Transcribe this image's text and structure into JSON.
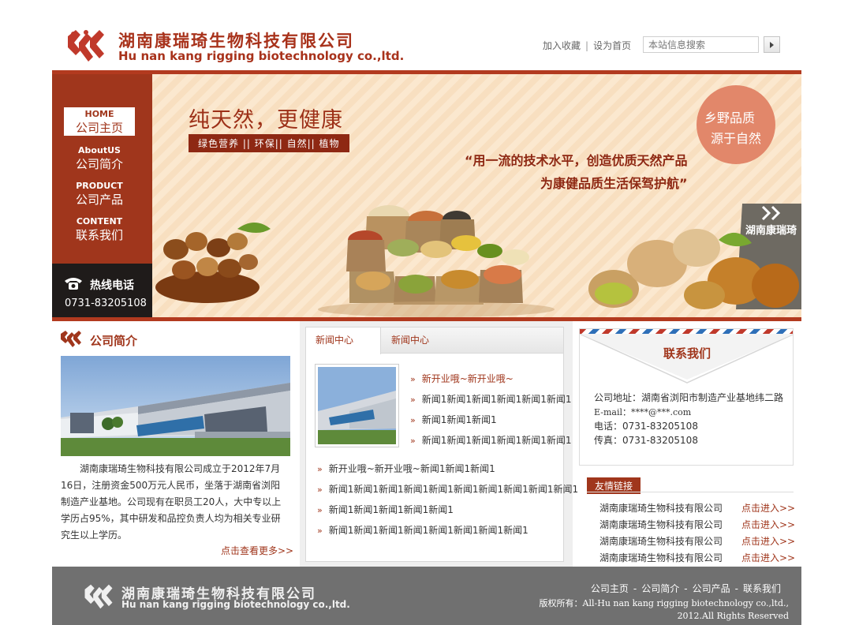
{
  "header": {
    "company_cn": "湖南康瑞琦生物科技有限公司",
    "company_en": "Hu nan kang rigging biotechnology co.,ltd.",
    "bookmark": "加入收藏",
    "separator": "|",
    "set_home": "设为首页",
    "search_placeholder": "本站信息搜索"
  },
  "nav": {
    "items": [
      {
        "en": "HOME",
        "cn": "公司主页"
      },
      {
        "en": "AboutUS",
        "cn": "公司简介"
      },
      {
        "en": "PRODUCT",
        "cn": "公司产品"
      },
      {
        "en": "CONTENT",
        "cn": "联系我们"
      }
    ],
    "hotline_label": "热线电话",
    "hotline_number": "0731-83205108"
  },
  "banner": {
    "slogan": "纯天然，更健康",
    "tag": "绿色营养 || 环保|| 自然|| 植物",
    "quote_line1": "“用一流的技术水平，创造优质天然产品",
    "quote_line2": "为康健品质生活保驾护航”",
    "badge_line1": "乡野品质",
    "badge_line2": "源于自然",
    "bag_label": "湖南康瑞琦"
  },
  "intro": {
    "title": "公司简介",
    "text": "湖南康瑞琦生物科技有限公司成立于2012年7月16日，注册资金500万元人民币，坐落于湖南省浏阳制造产业基地。公司现有在职员工20人，大中专以上学历占95%，其中研发和品控负责人均为相关专业研究生以上学历。",
    "more": "点击查看更多>>"
  },
  "news": {
    "tabs": [
      "新闻中心",
      "新闻中心"
    ],
    "items_top": [
      "新开业哦~新开业哦~",
      "新闻1新闻1新闻1新闻1新闻1新闻1",
      "新闻1新闻1新闻1",
      "新闻1新闻1新闻1新闻1新闻1新闻1"
    ],
    "items_bottom": [
      "新开业哦~新开业哦~新闻1新闻1新闻1",
      "新闻1新闻1新闻1新闻1新闻1新闻1新闻1新闻1新闻1新闻1",
      "新闻1新闻1新闻1新闻1新闻1",
      "新闻1新闻1新闻1新闻1新闻1新闻1新闻1新闻1"
    ]
  },
  "contact": {
    "title": "联系我们",
    "address": "公司地址：湖南省浏阳市制造产业基地纬二路",
    "email": "E-mail：****@***.com",
    "phone": "电话：0731-83205108",
    "fax": "传真：0731-83205108"
  },
  "links": {
    "title": "友情链接",
    "items": [
      {
        "name": "湖南康瑞琦生物科技有限公司",
        "go": "点击进入>>"
      },
      {
        "name": "湖南康瑞琦生物科技有限公司",
        "go": "点击进入>>"
      },
      {
        "name": "湖南康瑞琦生物科技有限公司",
        "go": "点击进入>>"
      },
      {
        "name": "湖南康瑞琦生物科技有限公司",
        "go": "点击进入>>"
      }
    ]
  },
  "footer": {
    "company_cn": "湖南康瑞琦生物科技有限公司",
    "company_en": "Hu nan kang rigging biotechnology co.,ltd.",
    "nav": [
      "公司主页",
      "公司简介",
      "公司产品",
      "联系我们"
    ],
    "nav_sep": "-",
    "copyright_line1": "版权所有：All-Hu nan kang rigging biotechnology co.,ltd.,",
    "copyright_line2": "2012.All Rights Reserved"
  },
  "colors": {
    "brand_red": "#a0361c",
    "banner_bg": "#fbe8cf",
    "footer_gray": "#707070"
  },
  "icons": [
    "logo-mark",
    "search-arrow-icon",
    "phone-icon",
    "list-bullet-icon"
  ]
}
